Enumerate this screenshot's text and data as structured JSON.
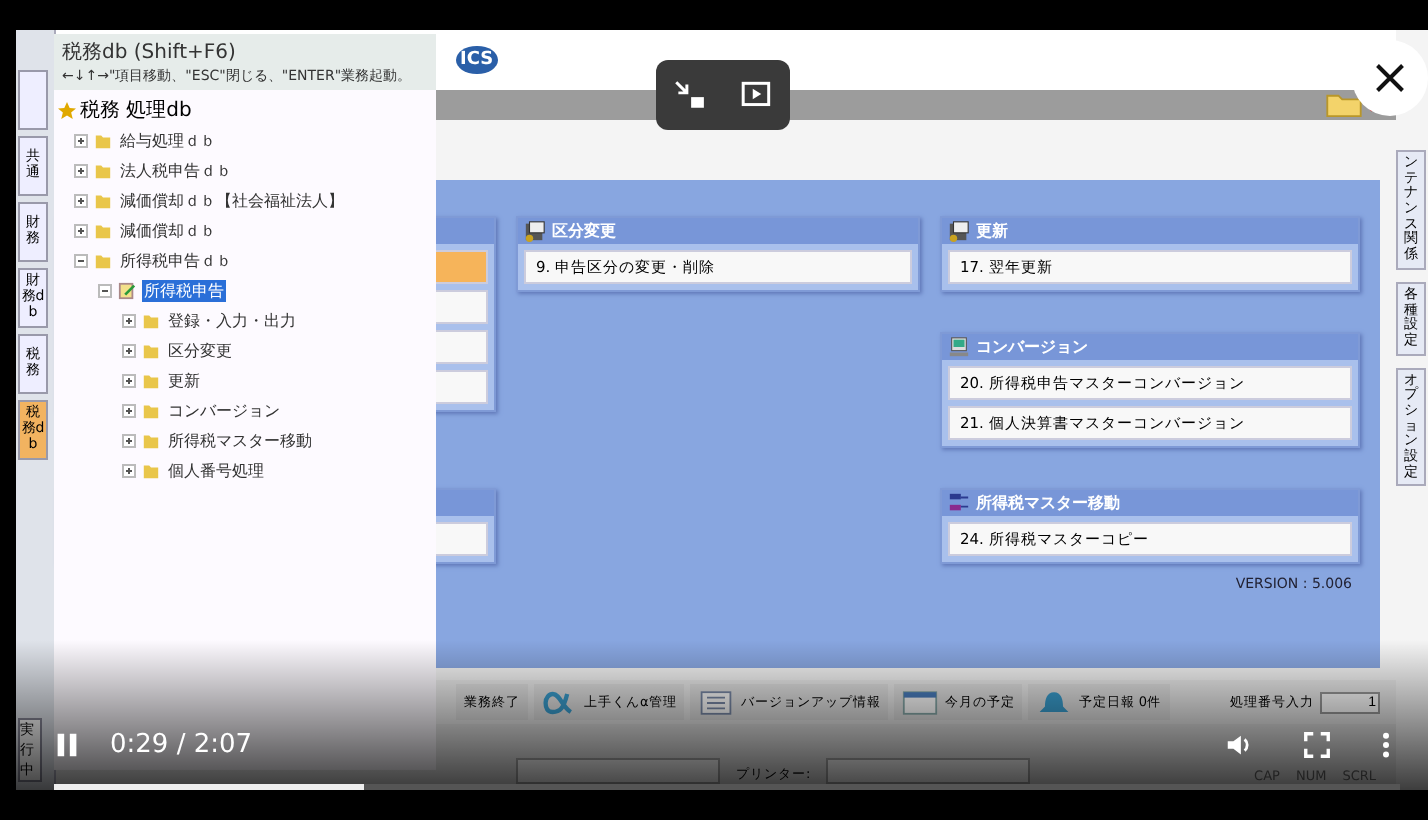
{
  "left_toolbar": {
    "items": [
      {
        "selected": false
      },
      {
        "label": "共通",
        "selected": false
      },
      {
        "label": "財務",
        "selected": false
      },
      {
        "label": "財務db",
        "selected": false
      },
      {
        "label": "税務",
        "selected": false
      },
      {
        "label": "税務db",
        "selected": true
      }
    ],
    "status": "実行中"
  },
  "header": {
    "logo": "ICS"
  },
  "right_tabs": [
    "ンテナンス関係",
    "各種設定",
    "オプション設定"
  ],
  "left_panels": [
    {
      "buttons": [
        {
          "selected": true
        },
        {
          "selected": false
        },
        {
          "selected": false
        },
        {
          "selected": false
        }
      ]
    },
    {
      "buttons": [
        {
          "selected": false
        }
      ]
    }
  ],
  "groups": [
    {
      "title": "区分変更",
      "kind": "folder",
      "items": [
        "9. 申告区分の変更・削除"
      ]
    },
    {
      "title": "更新",
      "kind": "folder",
      "items": [
        "17. 翌年更新"
      ]
    },
    {
      "title": "コンバージョン",
      "kind": "computer",
      "items": [
        "20. 所得税申告マスターコンバージョン",
        "21. 個人決算書マスターコンバージョン"
      ]
    },
    {
      "title": "所得税マスター移動",
      "kind": "network",
      "items": [
        "24. 所得税マスターコピー"
      ]
    }
  ],
  "version": "VERSION : 5.006",
  "toolbar": [
    {
      "kind": "text",
      "label": "業務終了"
    },
    {
      "kind": "alpha",
      "label": "上手くんα管理"
    },
    {
      "kind": "list",
      "label": "バージョンアップ情報"
    },
    {
      "kind": "calendar",
      "label": "今月の予定"
    },
    {
      "kind": "bell",
      "label": "予定日報 0件"
    }
  ],
  "number_input": {
    "label": "処理番号入力",
    "value": "1"
  },
  "status_bar": {
    "printer_label": "プリンター:",
    "keys": [
      "CAP",
      "NUM",
      "SCRL"
    ]
  },
  "tree_popup": {
    "title": "税務db (Shift+F6)",
    "hint": "←↓↑→\"項目移動、\"ESC\"閉じる、\"ENTER\"業務起動。",
    "root": "税務 処理db",
    "children": [
      {
        "label": "給与処理ｄｂ",
        "kind": "folder",
        "expanded": false,
        "selected": false
      },
      {
        "label": "法人税申告ｄｂ",
        "kind": "folder",
        "expanded": false,
        "selected": false
      },
      {
        "label": "減価償却ｄｂ【社会福祉法人】",
        "kind": "folder",
        "expanded": false,
        "selected": false
      },
      {
        "label": "減価償却ｄｂ",
        "kind": "folder",
        "expanded": false,
        "selected": false
      },
      {
        "label": "所得税申告ｄｂ",
        "kind": "folder",
        "expanded": true,
        "selected": false,
        "children": [
          {
            "label": "所得税申告",
            "kind": "document",
            "expanded": true,
            "selected": true,
            "children": [
              {
                "label": "登録・入力・出力",
                "kind": "folder",
                "expanded": false,
                "selected": false
              },
              {
                "label": "区分変更",
                "kind": "folder",
                "expanded": false,
                "selected": false
              },
              {
                "label": "更新",
                "kind": "folder",
                "expanded": false,
                "selected": false
              },
              {
                "label": "コンバージョン",
                "kind": "folder",
                "expanded": false,
                "selected": false
              },
              {
                "label": "所得税マスター移動",
                "kind": "folder",
                "expanded": false,
                "selected": false
              },
              {
                "label": "個人番号処理",
                "kind": "folder",
                "expanded": false,
                "selected": false
              }
            ]
          }
        ]
      }
    ]
  },
  "player": {
    "time": "0:29 / 2:07",
    "playing": true,
    "level": 0.23
  }
}
